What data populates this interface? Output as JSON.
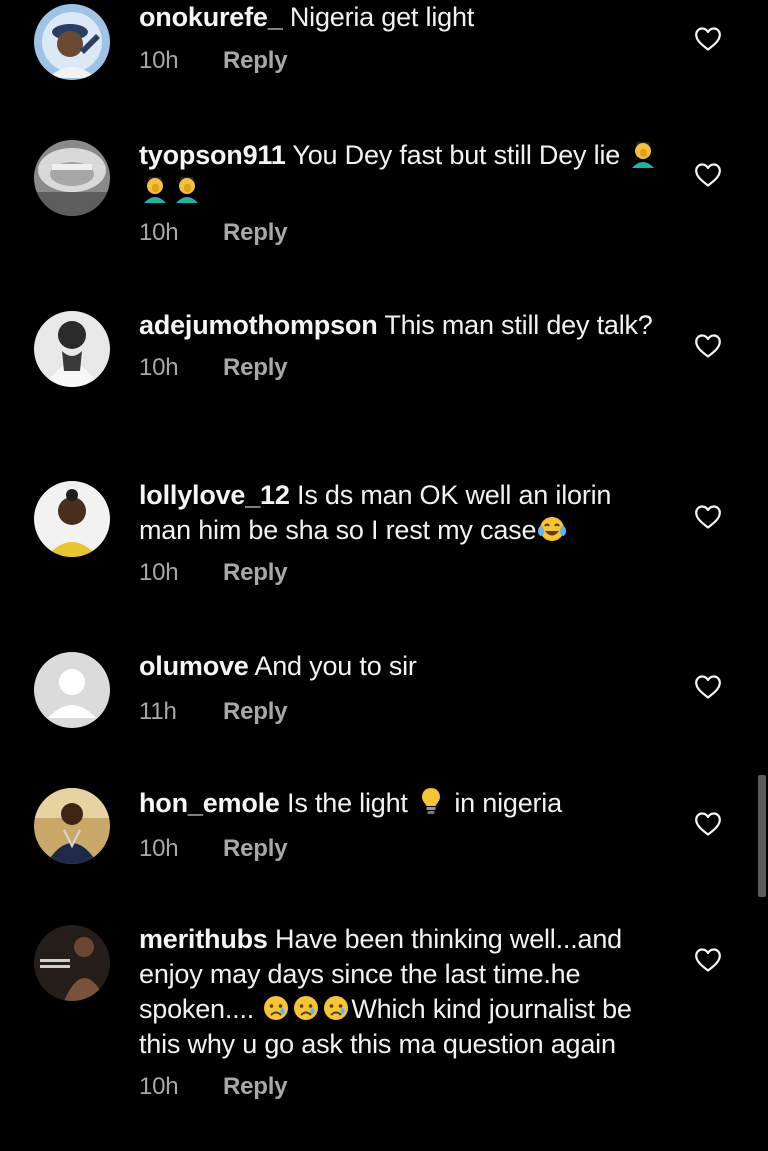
{
  "comments": [
    {
      "username": "onokurefe_",
      "text": "Nigeria get light",
      "time": "10h",
      "reply": "Reply",
      "avatar": "avatar-icon"
    },
    {
      "username": "tyopson911",
      "text": "You Dey fast but still Dey lie",
      "time": "10h",
      "reply": "Reply",
      "avatar": "avatar-icon"
    },
    {
      "username": "adejumothompson",
      "text": "This man still dey talk?",
      "time": "10h",
      "reply": "Reply",
      "avatar": "avatar-icon"
    },
    {
      "username": "lollylove_12",
      "text": "Is ds man OK well an ilorin man him be sha so I rest my case",
      "time": "10h",
      "reply": "Reply",
      "avatar": "avatar-icon"
    },
    {
      "username": "olumove",
      "text": "And you to sir",
      "time": "11h",
      "reply": "Reply",
      "avatar": "default-avatar-icon"
    },
    {
      "username": "hon_emole",
      "text_before": "Is the light",
      "text_after": "in nigeria",
      "time": "10h",
      "reply": "Reply",
      "avatar": "avatar-icon"
    },
    {
      "username": "merithubs",
      "text_before": "Have been thinking well...and enjoy may days since the last time.he spoken....",
      "text_after": "Which kind journalist be this why u go ask this ma question again",
      "time": "10h",
      "reply": "Reply",
      "avatar": "avatar-icon"
    }
  ],
  "icons": {
    "like": "heart-outline-icon",
    "facepalm": "man-facepalming-emoji",
    "laugh": "tears-of-joy-emoji",
    "bulb": "light-bulb-emoji",
    "cry": "crying-face-emoji"
  },
  "colors": {
    "background": "#000000",
    "text": "#f5f5f5",
    "secondary": "#a8a8a8"
  }
}
